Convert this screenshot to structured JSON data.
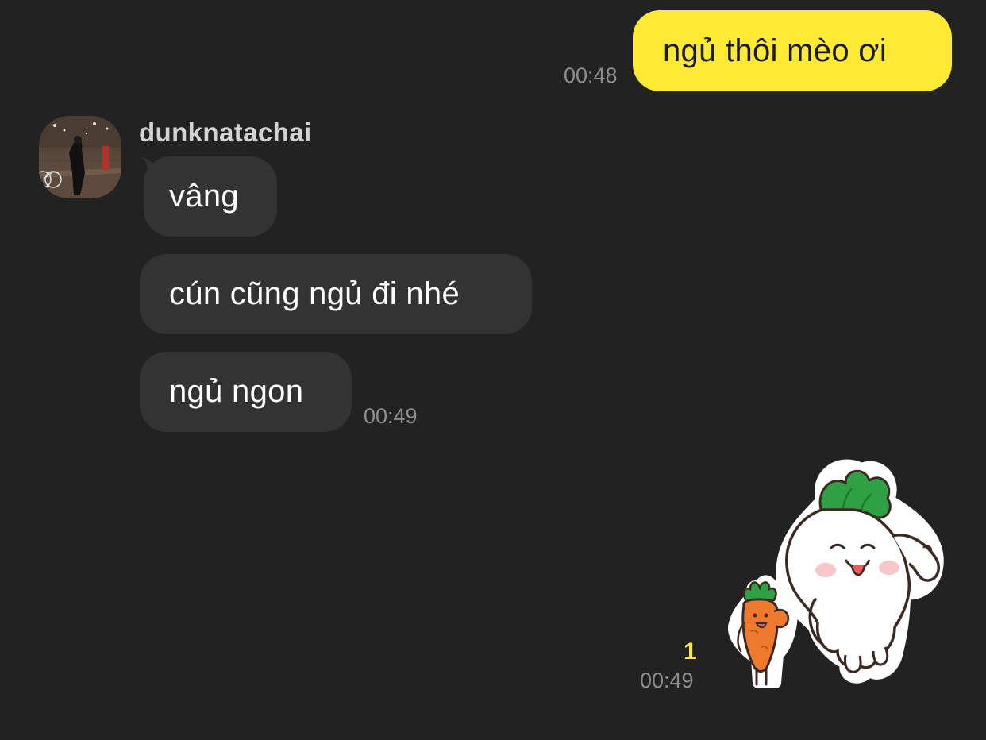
{
  "chat": {
    "messages": [
      {
        "sender": "me",
        "text": "ngủ thôi mèo ơi",
        "time": "00:48"
      },
      {
        "sender": "dunknatachai",
        "text": "vâng"
      },
      {
        "sender": "dunknatachai",
        "text": "cún cũng ngủ đi nhé"
      },
      {
        "sender": "dunknatachai",
        "text": "ngủ ngon",
        "time": "00:49"
      }
    ],
    "contact_name": "dunknatachai",
    "sticker": {
      "description": "radish-and-carrot-sticker",
      "unread_count": "1",
      "time": "00:49"
    }
  },
  "colors": {
    "background": "#222222",
    "my_bubble": "#fee934",
    "their_bubble": "#333333",
    "unread_count": "#fee934",
    "timestamp": "#8d8d8d"
  }
}
